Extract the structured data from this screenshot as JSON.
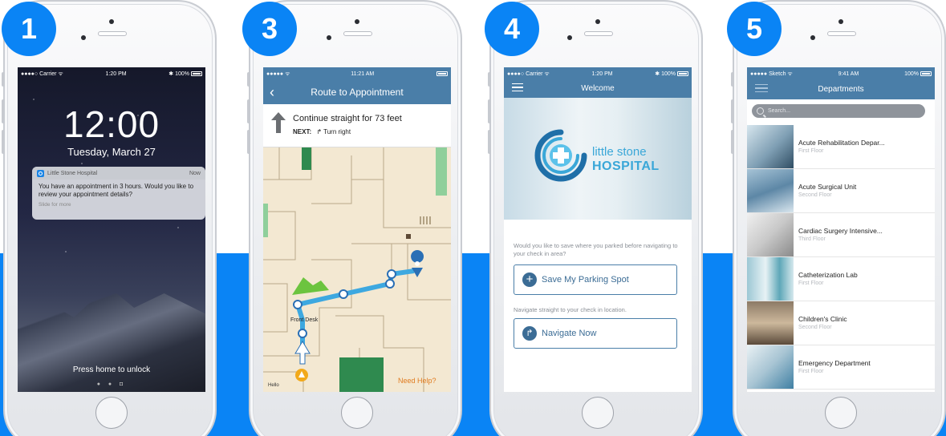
{
  "steps": [
    "1",
    "3",
    "4",
    "5"
  ],
  "colors": {
    "brand_blue": "#0a84f5",
    "app_bar": "#4a7ea8",
    "logo_teal": "#3aa7d8",
    "help_orange": "#e07b1f"
  },
  "lock_screen": {
    "status_left": "●●●●○ Carrier ᯤ",
    "status_time": "1:20 PM",
    "status_right": "✱ 100%",
    "clock": "12:00",
    "date": "Tuesday, March 27",
    "notification": {
      "app": "Little Stone Hospital",
      "time": "Now",
      "message": "You have an appointment in 3 hours. Would you like to review your appointment details?",
      "hint": "Slide for more"
    },
    "unlock_text": "Press home to unlock",
    "page_dots": "● ● ◘"
  },
  "route_screen": {
    "status_left": "●●●●● ᯤ",
    "status_time": "11:21 AM",
    "back_icon": "chevron-left-icon",
    "title": "Route to Appointment",
    "instruction": "Continue straight for 73 feet",
    "next_label": "NEXT:",
    "next_instruction": "Turn right",
    "front_desk": "Front Desk",
    "need_help": "Need Help?",
    "hello": "Hello"
  },
  "welcome_screen": {
    "status_left": "●●●●○ Carrier ᯤ",
    "status_time": "1:20 PM",
    "status_right": "✱ 100%",
    "title": "Welcome",
    "logo_line1": "little stone",
    "logo_line2": "HOSPITAL",
    "parking_question": "Would you like to save where you parked before navigating to your check in area?",
    "parking_button": "Save My Parking Spot",
    "navigate_question": "Navigate straight to your check in location.",
    "navigate_button": "Navigate Now"
  },
  "departments_screen": {
    "status_left": "●●●●● Sketch ᯤ",
    "status_time": "9:41 AM",
    "status_right": "100%",
    "title": "Departments",
    "search_placeholder": "Search...",
    "items": [
      {
        "name": "Acute Rehabilitation Depar...",
        "floor": "First Floor"
      },
      {
        "name": "Acute Surgical Unit",
        "floor": "Second Floor"
      },
      {
        "name": "Cardiac Surgery Intensive...",
        "floor": "Third Floor"
      },
      {
        "name": "Catheterization Lab",
        "floor": "First Floor"
      },
      {
        "name": "Children's Clinic",
        "floor": "Second Floor"
      },
      {
        "name": "Emergency Department",
        "floor": "First Floor"
      }
    ]
  }
}
